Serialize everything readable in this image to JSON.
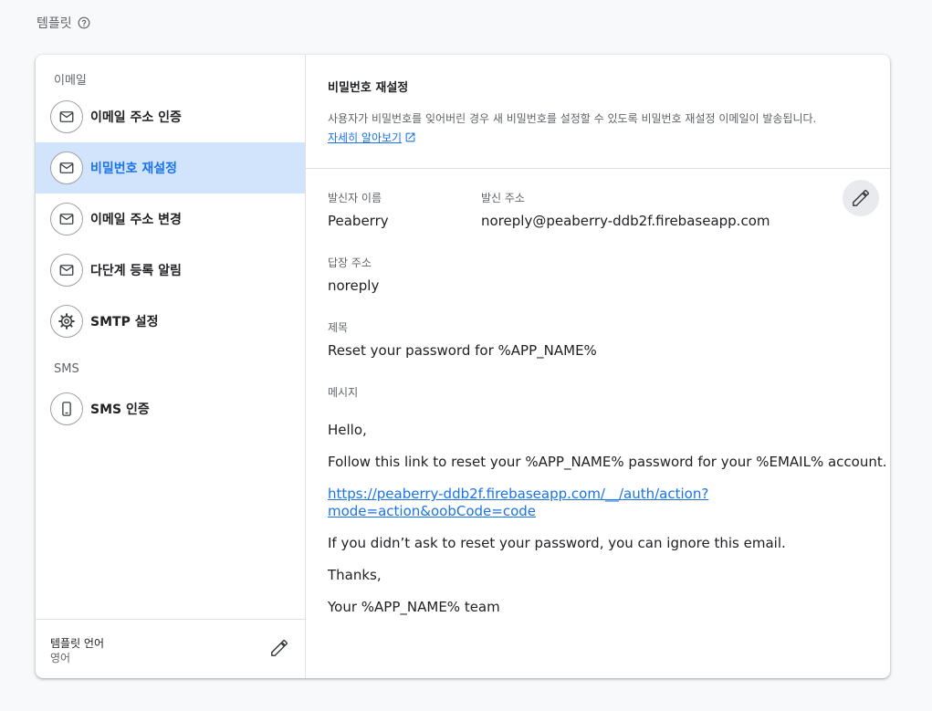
{
  "header": {
    "title": "템플릿",
    "help_icon": "help-circle-icon"
  },
  "sidebar": {
    "email_section_label": "이메일",
    "sms_section_label": "SMS",
    "items": [
      {
        "label": "이메일 주소 인증",
        "icon": "mail-icon"
      },
      {
        "label": "비밀번호 재설정",
        "icon": "mail-icon",
        "active": true
      },
      {
        "label": "이메일 주소 변경",
        "icon": "mail-icon"
      },
      {
        "label": "다단계 등록 알림",
        "icon": "mail-icon"
      },
      {
        "label": "SMTP 설정",
        "icon": "gear-icon"
      }
    ],
    "sms_items": [
      {
        "label": "SMS 인증",
        "icon": "phone-icon"
      }
    ],
    "footer": {
      "title": "템플릿 언어",
      "value": "영어",
      "edit_icon": "pencil-icon"
    }
  },
  "main": {
    "title": "비밀번호 재설정",
    "description": "사용자가 비밀번호를 잊어버린 경우 새 비밀번호를 설정할 수 있도록 비밀번호 재설정 이메일이 발송됩니다.",
    "learn_more": "자세히 알아보기",
    "sender_name_label": "발신자 이름",
    "sender_name": "Peaberry",
    "sender_address_label": "발신 주소",
    "sender_address": "noreply@peaberry-ddb2f.firebaseapp.com",
    "reply_to_label": "답장 주소",
    "reply_to": "noreply",
    "subject_label": "제목",
    "subject": "Reset your password for %APP_NAME%",
    "message_label": "메시지",
    "message": {
      "greeting": "Hello,",
      "line1": "Follow this link to reset your %APP_NAME% password for your %EMAIL% account.",
      "link_line1": "https://peaberry-ddb2f.firebaseapp.com/__/auth/action?",
      "link_line2": "mode=action&oobCode=code",
      "line2": "If you didn’t ask to reset your password, you can ignore this email.",
      "thanks": "Thanks,",
      "signature": "Your %APP_NAME% team"
    }
  },
  "colors": {
    "accent": "#1a73e8",
    "active_bg": "#d2e3fc"
  }
}
